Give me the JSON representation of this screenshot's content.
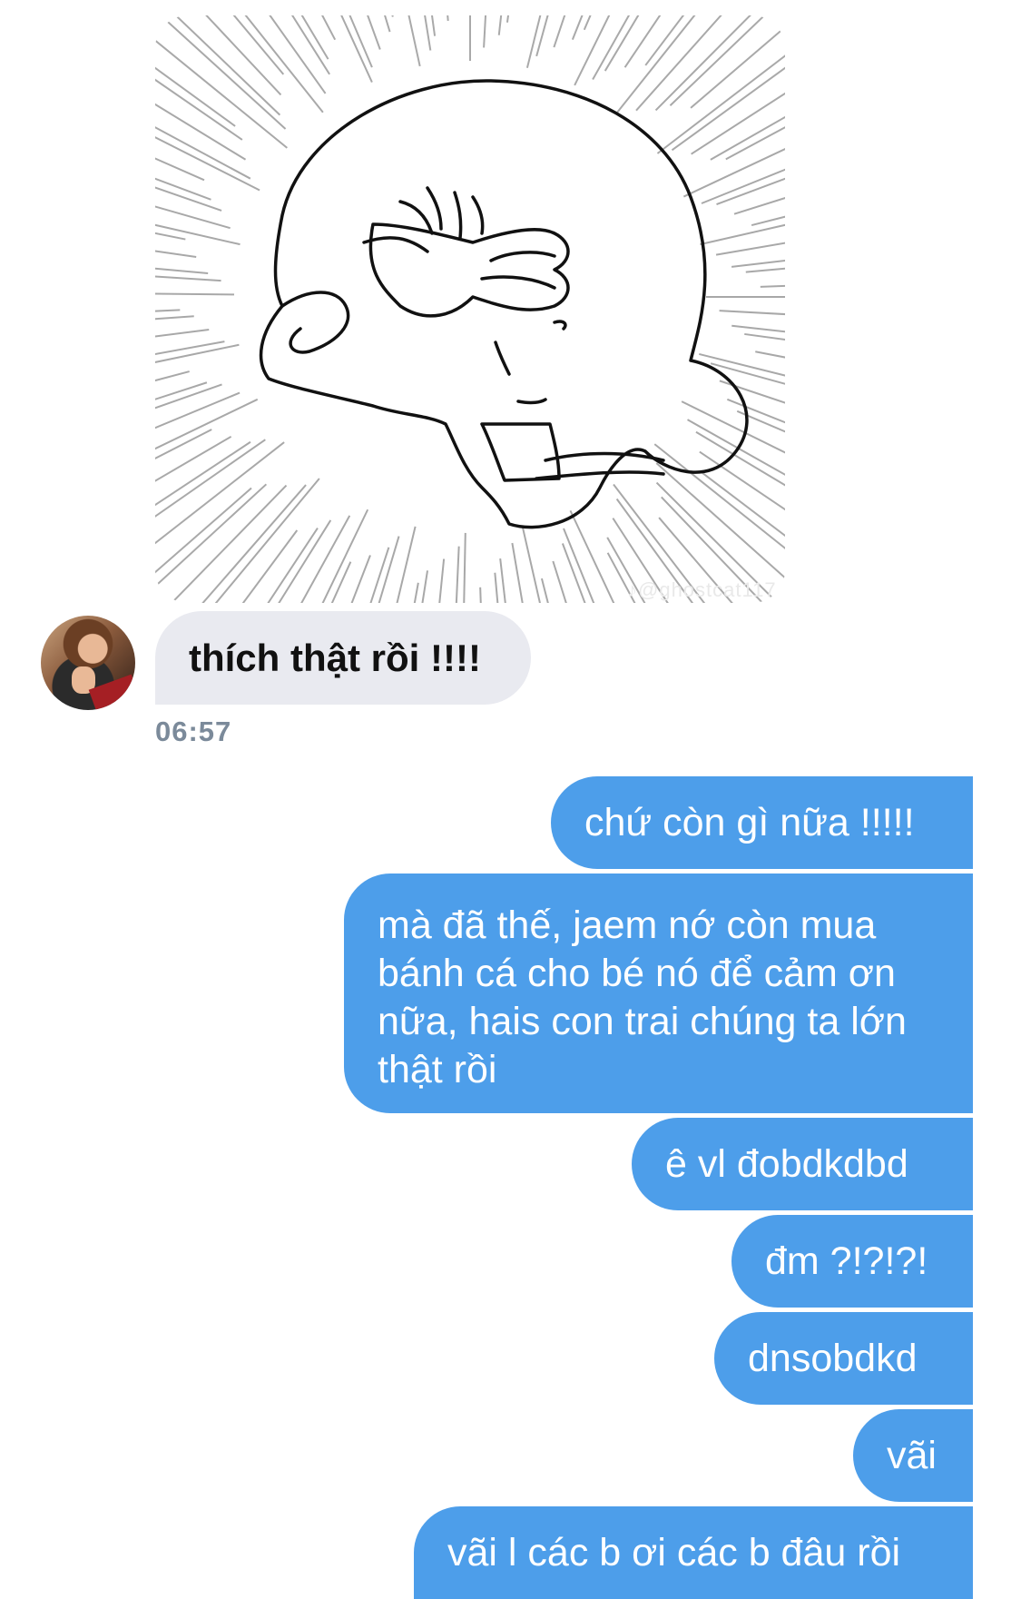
{
  "incoming": {
    "sticker_watermark": "♪@ghostcat117",
    "message": "thích thật rồi !!!!",
    "time": "06:57"
  },
  "outgoing": [
    "chứ còn gì nữa !!!!!",
    "mà đã thế, jaem nớ còn mua bánh cá cho bé nó để cảm ơn nữa, hais con trai chúng ta lớn thật rồi",
    "ê vl đobdkdbd",
    "đm ?!?!?!",
    "dnsobdkd",
    "vãi",
    "vãi l các b ơi các b đâu rồi"
  ],
  "colors": {
    "outgoing_bubble": "#4d9eea",
    "incoming_bubble": "#e9eaf0",
    "timestamp": "#7b8a9a"
  }
}
